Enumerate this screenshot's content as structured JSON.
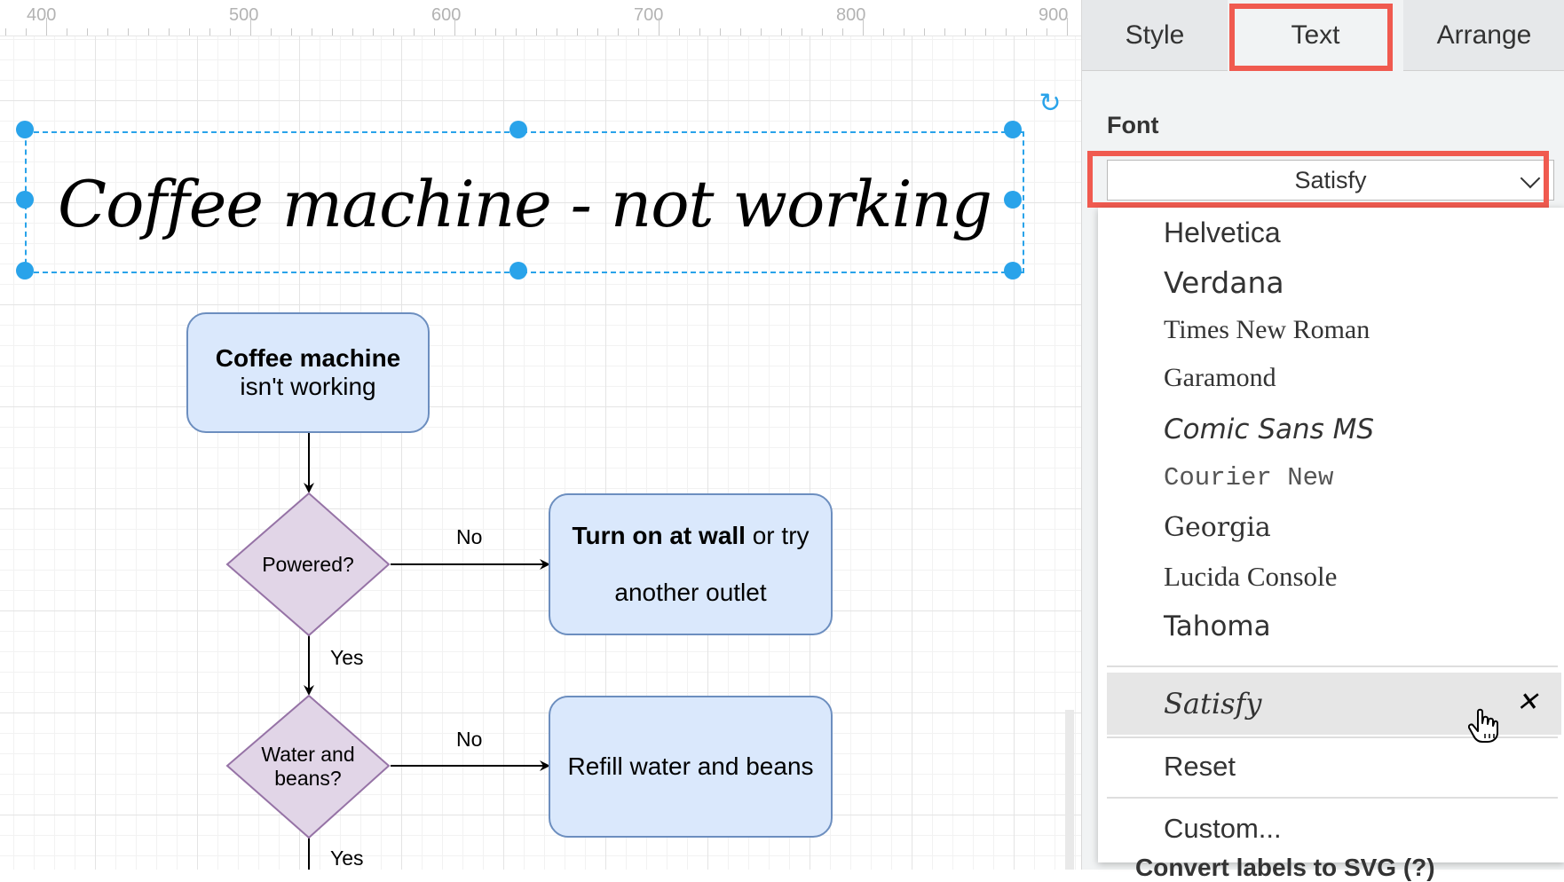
{
  "ruler": {
    "labels": [
      "400",
      "500",
      "600",
      "700",
      "800",
      "900"
    ]
  },
  "title_text": "Coffee machine - not working",
  "flowchart": {
    "start_bold": "Coffee machine",
    "start_rest": "isn't working",
    "decision1": "Powered?",
    "action1_bold": "Turn on at wall",
    "action1_rest": " or try",
    "action1_line2": "another outlet",
    "decision2_line1": "Water and",
    "decision2_line2": "beans?",
    "action2": "Refill water and beans",
    "edge_no1": "No",
    "edge_yes1": "Yes",
    "edge_no2": "No",
    "edge_yes2": "Yes"
  },
  "panel": {
    "tabs": [
      {
        "label": "Style"
      },
      {
        "label": "Text",
        "active": true
      },
      {
        "label": "Arrange"
      }
    ],
    "font_heading": "Font",
    "font_selected": "Satisfy",
    "dropdown": {
      "fonts": [
        "Helvetica",
        "Verdana",
        "Times New Roman",
        "Garamond",
        "Comic Sans MS",
        "Courier New",
        "Georgia",
        "Lucida Console",
        "Tahoma"
      ],
      "custom_font": "Satisfy",
      "reset": "Reset",
      "custom": "Custom..."
    },
    "bottom_partial": "Convert labels to SVG (?)"
  },
  "colors": {
    "selection": "#29a3ea",
    "highlight": "#f05a4f",
    "box_fill": "#dae8fc",
    "box_stroke": "#6c8ebf",
    "diamond_fill": "#e1d5e7",
    "diamond_stroke": "#9673a6"
  },
  "icons": [
    "rotate-icon",
    "chevron-down-icon",
    "close-icon",
    "hand-cursor-icon"
  ]
}
